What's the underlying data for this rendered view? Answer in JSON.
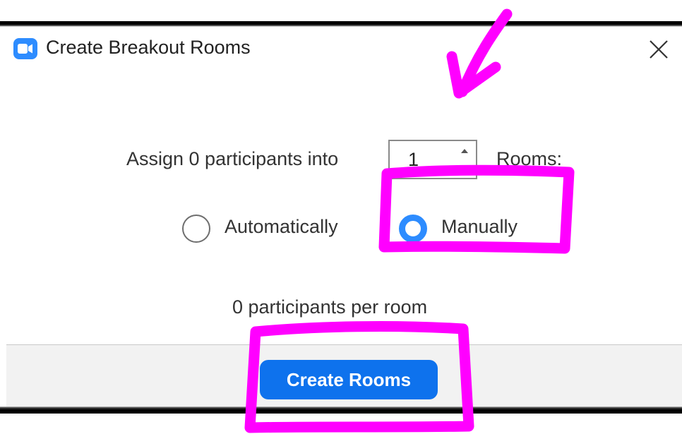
{
  "dialog": {
    "title": "Create Breakout Rooms",
    "app_icon": "zoom-video-camera-icon",
    "close_icon": "close-icon"
  },
  "assign": {
    "label": "Assign 0 participants into",
    "room_count": "1",
    "rooms_label": "Rooms:"
  },
  "assignment_mode": {
    "options": [
      {
        "label": "Automatically",
        "selected": false
      },
      {
        "label": "Manually",
        "selected": true
      }
    ]
  },
  "summary": {
    "per_room": "0 participants per room"
  },
  "footer": {
    "create_label": "Create Rooms"
  },
  "colors": {
    "accent": "#2d8cff",
    "button": "#0e72ed",
    "annotation": "#ff00ff",
    "footer_bg": "#f2f2f2"
  }
}
